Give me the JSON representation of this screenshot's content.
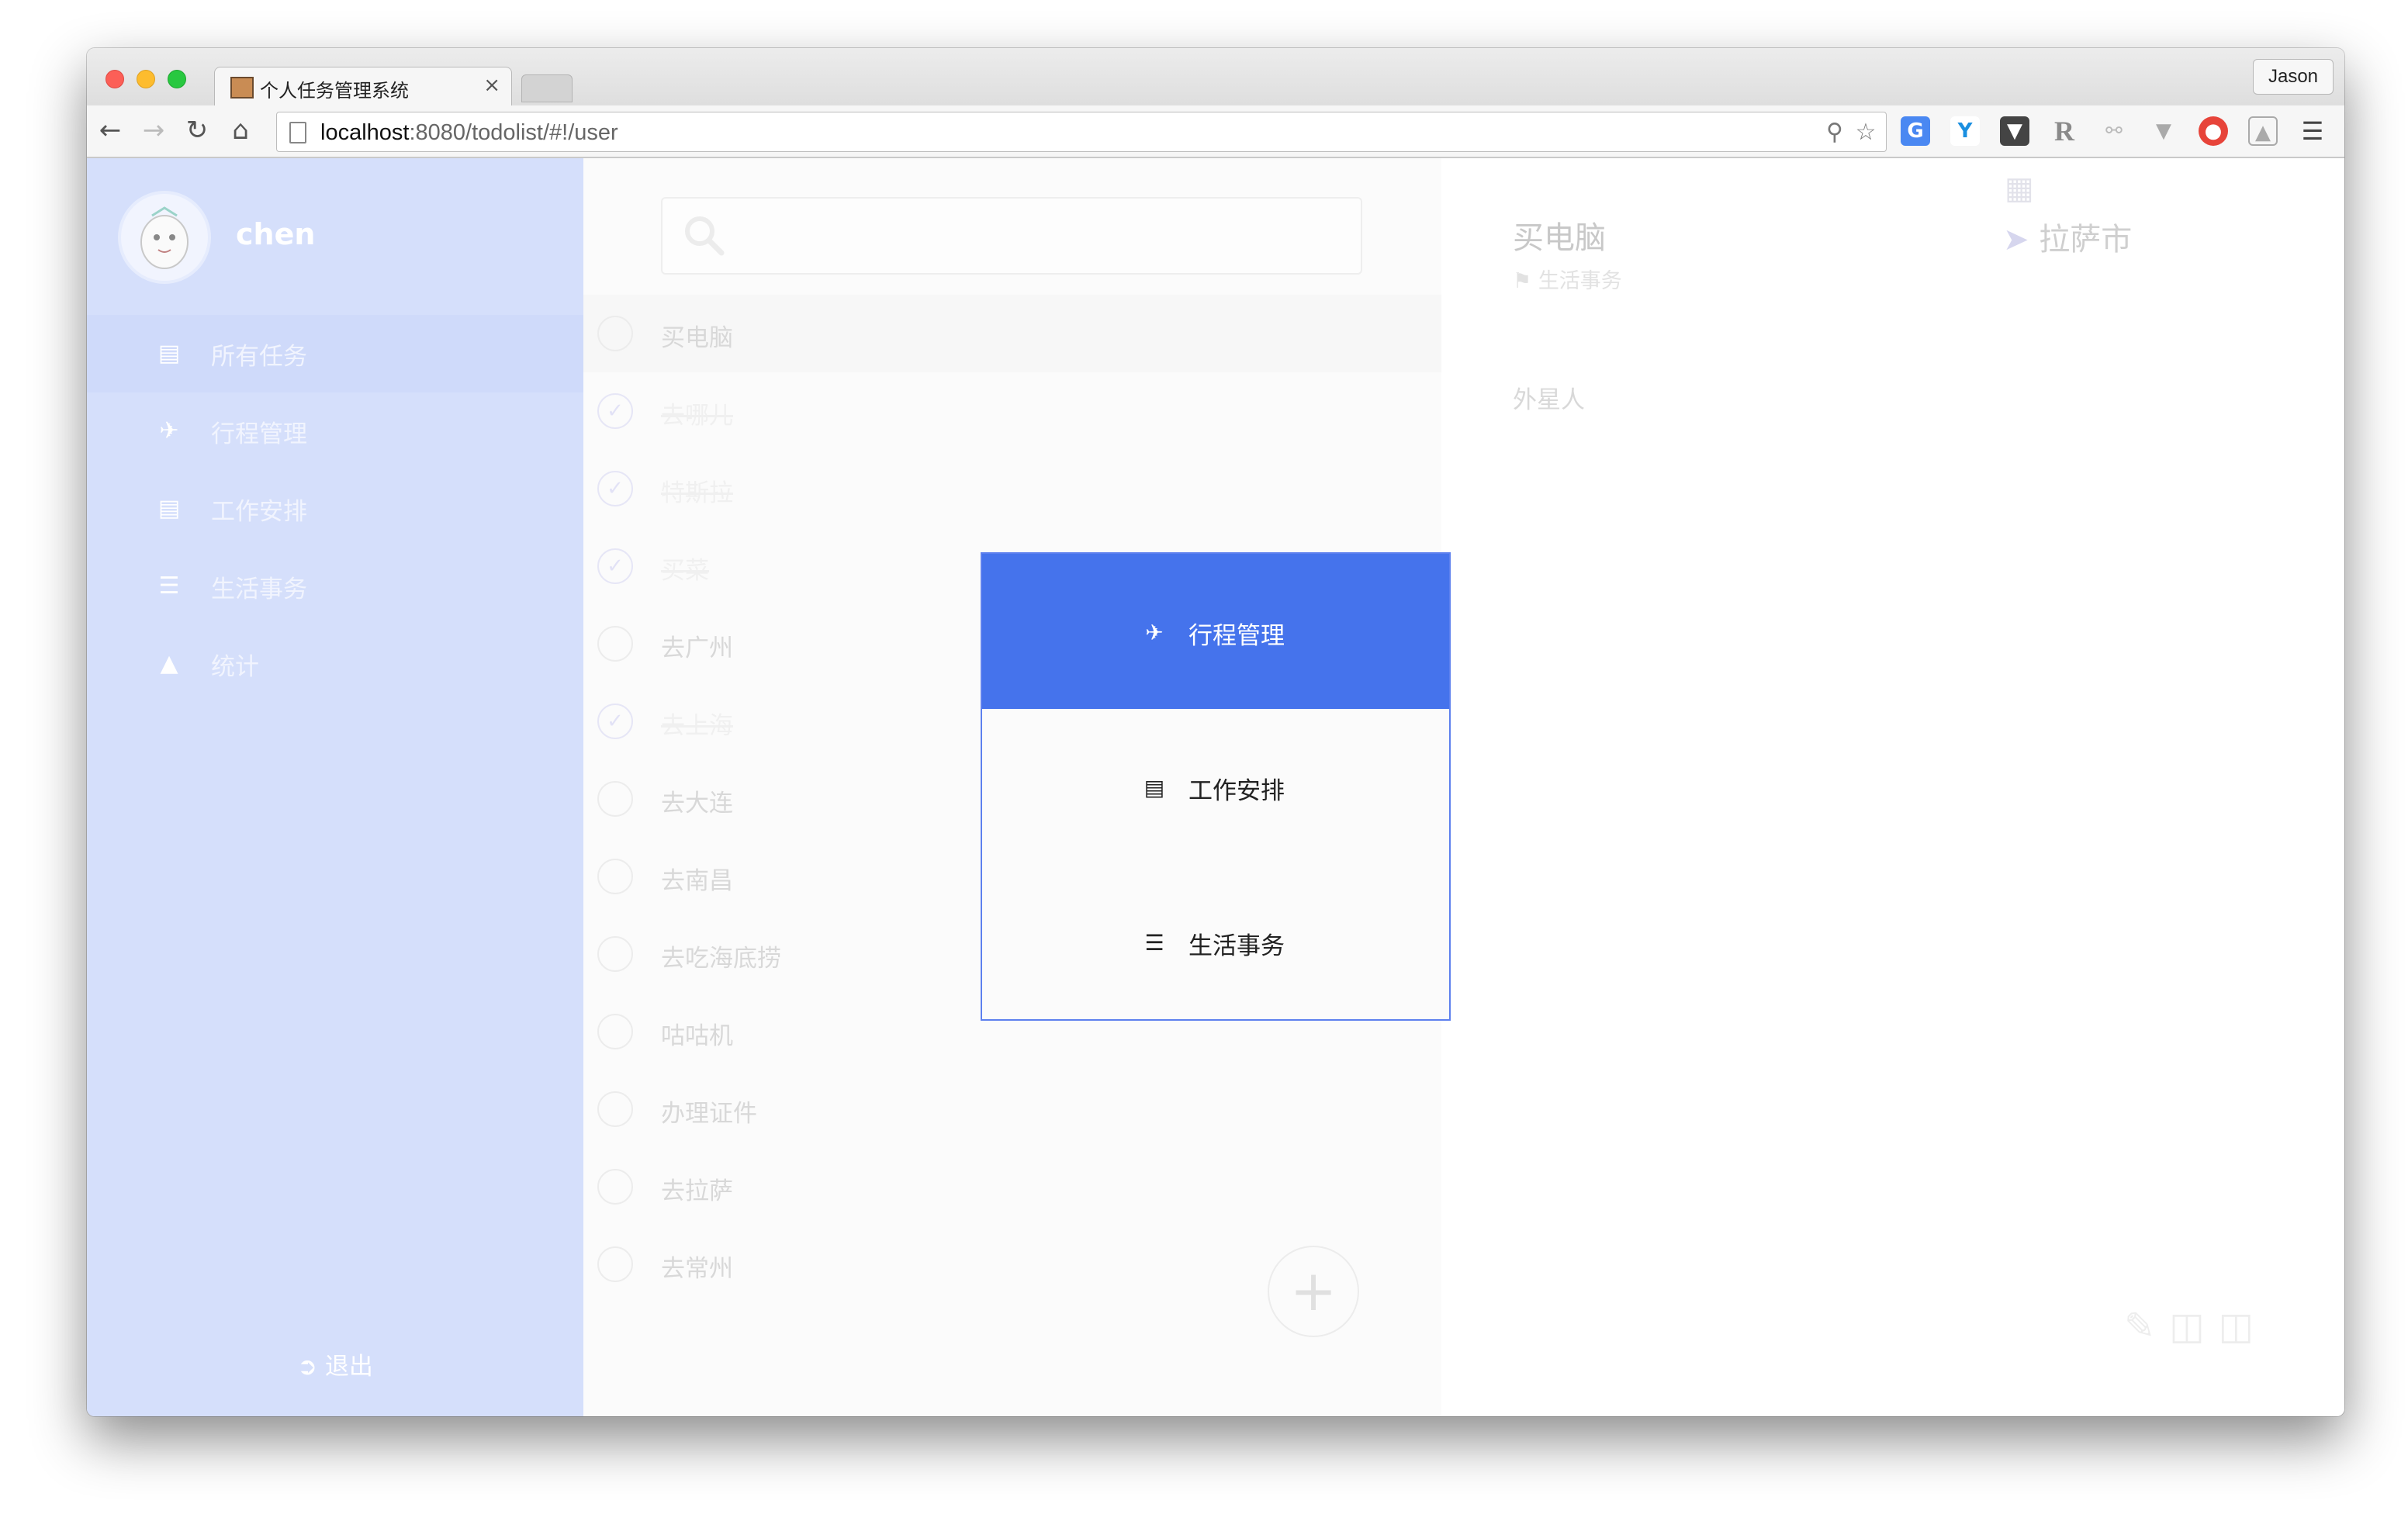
{
  "browser": {
    "tab_title": "个人任务管理系统",
    "tab_close": "×",
    "profile_name": "Jason",
    "url_host": "localhost",
    "url_path": ":8080/todolist/#!/user",
    "extension_r": "R"
  },
  "sidebar": {
    "user_name": "chen",
    "items": [
      {
        "label": "所有任务",
        "icon": "list-icon",
        "active": true
      },
      {
        "label": "行程管理",
        "icon": "plane-icon",
        "active": false
      },
      {
        "label": "工作安排",
        "icon": "card-icon",
        "active": false
      },
      {
        "label": "生活事务",
        "icon": "bullet-list-icon",
        "active": false
      },
      {
        "label": "统计",
        "icon": "area-chart-icon",
        "active": false
      }
    ],
    "logout_label": "退出"
  },
  "task_list": {
    "search_value": "",
    "tasks": [
      {
        "label": "买电脑",
        "done": false,
        "selected": true
      },
      {
        "label": "去哪儿",
        "done": true
      },
      {
        "label": "特斯拉",
        "done": true
      },
      {
        "label": "买菜",
        "done": true
      },
      {
        "label": "去广州",
        "done": false
      },
      {
        "label": "去上海",
        "done": true
      },
      {
        "label": "去大连",
        "done": false
      },
      {
        "label": "去南昌",
        "done": false
      },
      {
        "label": "去吃海底捞",
        "done": false
      },
      {
        "label": "咕咕机",
        "done": false
      },
      {
        "label": "办理证件",
        "done": false
      },
      {
        "label": "去拉萨",
        "done": false
      },
      {
        "label": "去常州",
        "done": false
      }
    ]
  },
  "detail": {
    "title": "买电脑",
    "tag": "生活事务",
    "location": "拉萨市",
    "note": "外星人"
  },
  "category_popup": {
    "items": [
      {
        "label": "行程管理",
        "icon": "plane-icon",
        "highlighted": true
      },
      {
        "label": "工作安排",
        "icon": "card-icon",
        "highlighted": false
      },
      {
        "label": "生活事务",
        "icon": "bullet-list-icon",
        "highlighted": false
      }
    ]
  },
  "colors": {
    "sidebar_bg": "#d5dffb",
    "accent": "#4573ec"
  }
}
